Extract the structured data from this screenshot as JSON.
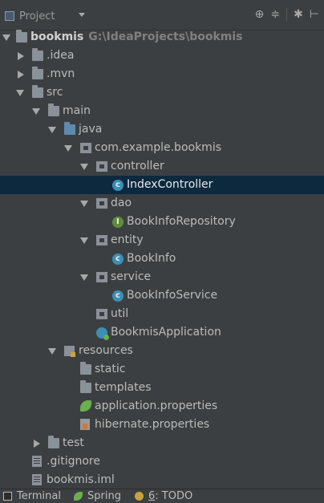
{
  "toolbar": {
    "title": "Project",
    "icons": [
      "locate-icon",
      "collapse-all-icon",
      "gear-icon",
      "hide-icon"
    ],
    "icon_glyphs": [
      "⊕",
      "≑",
      "✱",
      "⊢"
    ]
  },
  "tree": {
    "root": {
      "label": "bookmis",
      "path": "G:\\IdeaProjects\\bookmis"
    },
    "idea": ".idea",
    "mvn": ".mvn",
    "src": "src",
    "main": "main",
    "java": "java",
    "pkg": "com.example.bookmis",
    "controller": "controller",
    "index_controller": "IndexController",
    "dao": "dao",
    "book_info_repository": "BookInfoRepository",
    "entity": "entity",
    "book_info": "BookInfo",
    "service": "service",
    "book_info_service": "BookInfoService",
    "util": "util",
    "bookmis_application": "BookmisApplication",
    "resources": "resources",
    "static": "static",
    "templates": "templates",
    "application_properties": "application.properties",
    "hibernate_properties": "hibernate.properties",
    "test": "test",
    "gitignore": ".gitignore",
    "iml": "bookmis.iml"
  },
  "bottom_bar": {
    "terminal": "Terminal",
    "spring": "Spring",
    "todo_number": "6",
    "todo_label": ": TODO"
  },
  "colors": {
    "background": "#3c3f41",
    "selection": "#0d293e",
    "class_icon": "#3c8fb3",
    "interface_icon": "#5f8c3a"
  }
}
